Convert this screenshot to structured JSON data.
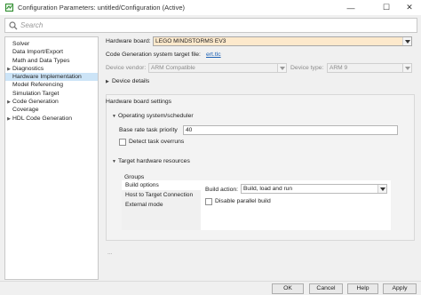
{
  "window": {
    "title": "Configuration Parameters: untitled/Configuration (Active)",
    "minimize_glyph": "—",
    "maximize_glyph": "☐",
    "close_glyph": "✕"
  },
  "search": {
    "placeholder": "Search"
  },
  "tree": {
    "items": [
      {
        "label": "Solver",
        "arrow": ""
      },
      {
        "label": "Data Import/Export",
        "arrow": ""
      },
      {
        "label": "Math and Data Types",
        "arrow": ""
      },
      {
        "label": "Diagnostics",
        "arrow": "▶"
      },
      {
        "label": "Hardware Implementation",
        "arrow": "",
        "selected": true
      },
      {
        "label": "Model Referencing",
        "arrow": ""
      },
      {
        "label": "Simulation Target",
        "arrow": ""
      },
      {
        "label": "Code Generation",
        "arrow": "▶"
      },
      {
        "label": "Coverage",
        "arrow": ""
      },
      {
        "label": "HDL Code Generation",
        "arrow": "▶"
      }
    ]
  },
  "hardware": {
    "board_label": "Hardware board:",
    "board_value": "LEGO MINDSTORMS EV3",
    "target_file_label": "Code Generation system target file:",
    "target_file_link": "ert.tlc",
    "vendor_label": "Device vendor:",
    "vendor_value": "ARM Compatible",
    "type_label": "Device type:",
    "type_value": "ARM 9",
    "device_details": "Device details"
  },
  "board_settings": {
    "title": "Hardware board settings",
    "os_section": "Operating system/scheduler",
    "base_rate_label": "Base rate task priority",
    "base_rate_value": "40",
    "detect_overruns_label": "Detect task overruns",
    "target_resources_section": "Target hardware resources",
    "groups_label": "Groups",
    "groups": [
      "Build options",
      "Host to Target Connection",
      "External mode"
    ],
    "build_action_label": "Build action:",
    "build_action_value": "Build, load and run",
    "parallel_build_label": "Disable parallel build",
    "ellipsis": "..."
  },
  "buttons": {
    "ok": "OK",
    "cancel": "Cancel",
    "help": "Help",
    "apply": "Apply"
  },
  "colors": {
    "selection": "#cce4f7",
    "board_highlight": "#fde9cc",
    "link": "#1a5fb4"
  }
}
